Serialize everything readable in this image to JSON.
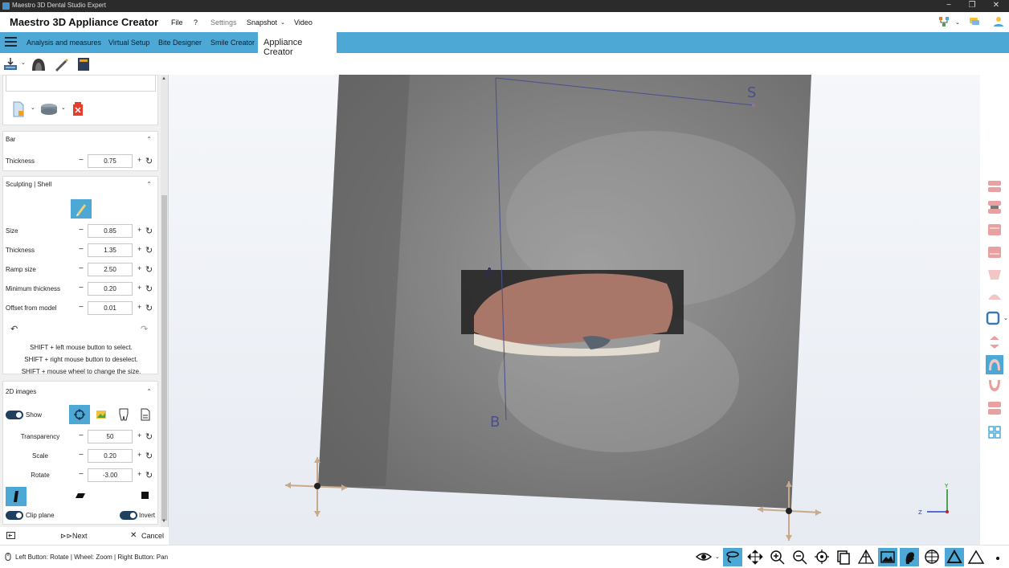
{
  "window": {
    "title": "Maestro 3D Dental Studio Expert",
    "controls": [
      "−",
      "❐",
      "✕"
    ]
  },
  "menubar": {
    "app_title": "Maestro 3D Appliance Creator",
    "items": [
      "File",
      "?",
      "Settings",
      "Snapshot",
      "Video"
    ]
  },
  "tabs": {
    "items": [
      "Analysis and measures",
      "Virtual Setup",
      "Bite Designer",
      "Smile Creator"
    ],
    "active": "Appliance Creator"
  },
  "bar": {
    "header": "Bar",
    "thickness_label": "Thickness",
    "thickness_value": "0.75"
  },
  "sculpting": {
    "header": "Sculpting | Shell",
    "size_label": "Size",
    "size_value": "0.85",
    "thickness_label": "Thickness",
    "thickness_value": "1.35",
    "ramp_label": "Ramp size",
    "ramp_value": "2.50",
    "minthick_label": "Minimum thickness",
    "minthick_value": "0.20",
    "offset_label": "Offset from model",
    "offset_value": "0.01",
    "hint1": "SHIFT + left mouse button to select.",
    "hint2": "SHIFT + right mouse button to deselect.",
    "hint3": "SHIFT + mouse wheel to change the size."
  },
  "images2d": {
    "header": "2D images",
    "show_label": "Show",
    "transparency_label": "Transparency",
    "transparency_value": "50",
    "scale_label": "Scale",
    "scale_value": "0.20",
    "rotate_label": "Rotate",
    "rotate_value": "-3.00",
    "clip_label": "Clip plane",
    "invert_label": "Invert"
  },
  "controls": {
    "minus": "−",
    "plus": "+",
    "reset": "↻",
    "chevron": "⌃",
    "undo": "↶",
    "redo": "↷"
  },
  "bottomnav": {
    "next": "Next",
    "cancel": "Cancel"
  },
  "viewport": {
    "landmarks": {
      "s": "S",
      "a": "A",
      "b": "B"
    },
    "axes": {
      "y": "Y",
      "z": "Z"
    }
  },
  "status": {
    "text": "Left Button: Rotate | Wheel: Zoom | Right Button: Pan"
  },
  "colors": {
    "accent": "#4ea8d6",
    "toggle": "#1e3f5e",
    "titlebar": "#2b2b2b"
  }
}
